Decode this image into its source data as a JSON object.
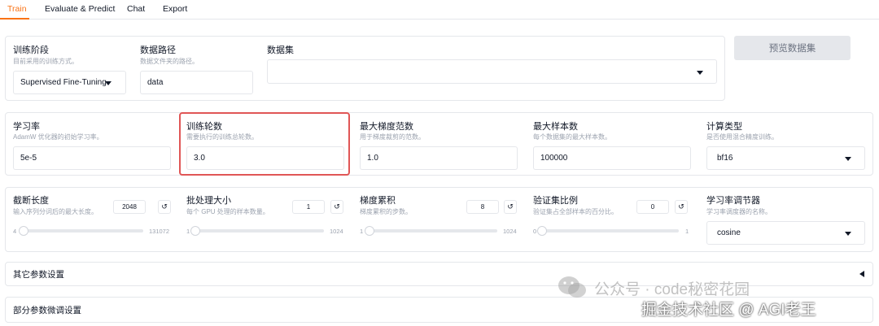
{
  "tabs": [
    {
      "label": "Train"
    },
    {
      "label": "Evaluate & Predict"
    },
    {
      "label": "Chat"
    },
    {
      "label": "Export"
    }
  ],
  "row1": {
    "stage": {
      "label": "训练阶段",
      "desc": "目前采用的训练方式。",
      "value": "Supervised Fine-Tuning"
    },
    "data_path": {
      "label": "数据路径",
      "desc": "数据文件夹的路径。",
      "value": "data"
    },
    "dataset": {
      "label": "数据集",
      "value": ""
    },
    "preview_button": "预览数据集"
  },
  "row2": {
    "learning_rate": {
      "label": "学习率",
      "desc": "AdamW 优化器的初始学习率。",
      "value": "5e-5"
    },
    "epochs": {
      "label": "训练轮数",
      "desc": "需要执行的训练总轮数。",
      "value": "3.0"
    },
    "max_grad_norm": {
      "label": "最大梯度范数",
      "desc": "用于梯度裁剪的范数。",
      "value": "1.0"
    },
    "max_samples": {
      "label": "最大样本数",
      "desc": "每个数据集的最大样本数。",
      "value": "100000"
    },
    "compute_type": {
      "label": "计算类型",
      "desc": "是否使用混合精度训练。",
      "value": "bf16"
    }
  },
  "row3": {
    "cutoff_len": {
      "label": "截断长度",
      "desc": "输入序列分词后的最大长度。",
      "value": "2048",
      "min": "4",
      "max": "131072",
      "fraction": 0.012
    },
    "batch_size": {
      "label": "批处理大小",
      "desc": "每个 GPU 处理的样本数量。",
      "value": "1",
      "min": "1",
      "max": "1024",
      "fraction": 0.0
    },
    "grad_accum": {
      "label": "梯度累积",
      "desc": "梯度累积的步数。",
      "value": "8",
      "min": "1",
      "max": "1024",
      "fraction": 0.007
    },
    "val_size": {
      "label": "验证集比例",
      "desc": "验证集占全部样本的百分比。",
      "value": "0",
      "min": "0",
      "max": "1",
      "fraction": 0.0
    },
    "lr_scheduler": {
      "label": "学习率调节器",
      "desc": "学习率调度器的名称。",
      "value": "cosine"
    }
  },
  "accordions": {
    "other_params": "其它参数设置",
    "partial_params": "部分参数微调设置"
  },
  "watermark": {
    "line1": "公众号 · code秘密花园",
    "line2": "掘金技术社区 @ AGI老王"
  },
  "colors": {
    "accent": "#f97316",
    "highlight": "#e05656"
  }
}
